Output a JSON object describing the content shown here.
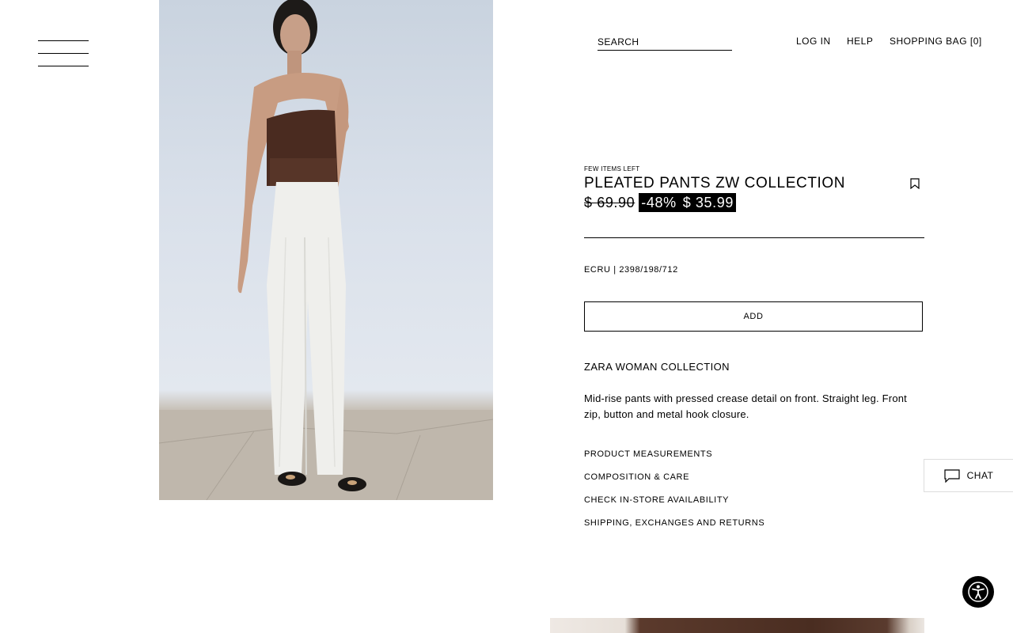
{
  "header": {
    "menu_icon": "hamburger-menu-icon",
    "search_placeholder": "SEARCH",
    "login_label": "LOG IN",
    "help_label": "HELP",
    "bag_label": "SHOPPING BAG [0]"
  },
  "product": {
    "stock_note": "FEW ITEMS LEFT",
    "title": "PLEATED PANTS ZW COLLECTION",
    "bookmark_icon": "bookmark-icon",
    "old_price": "$ 69.90",
    "discount": "-48%",
    "sale_price": "$ 35.99",
    "color_ref": "ECRU | 2398/198/712",
    "add_label": "ADD",
    "collection": "ZARA WOMAN COLLECTION",
    "description": "Mid-rise pants with pressed crease detail on front. Straight leg. Front zip, button and metal hook closure.",
    "links": [
      "PRODUCT MEASUREMENTS",
      "COMPOSITION & CARE",
      "CHECK IN-STORE AVAILABILITY",
      "SHIPPING, EXCHANGES AND RETURNS"
    ]
  },
  "chat": {
    "label": "CHAT",
    "icon": "chat-bubble-icon"
  },
  "accessibility": {
    "icon": "accessibility-icon"
  },
  "colors": {
    "sale_bg": "#000000",
    "sale_text": "#ffffff",
    "text": "#000000"
  }
}
